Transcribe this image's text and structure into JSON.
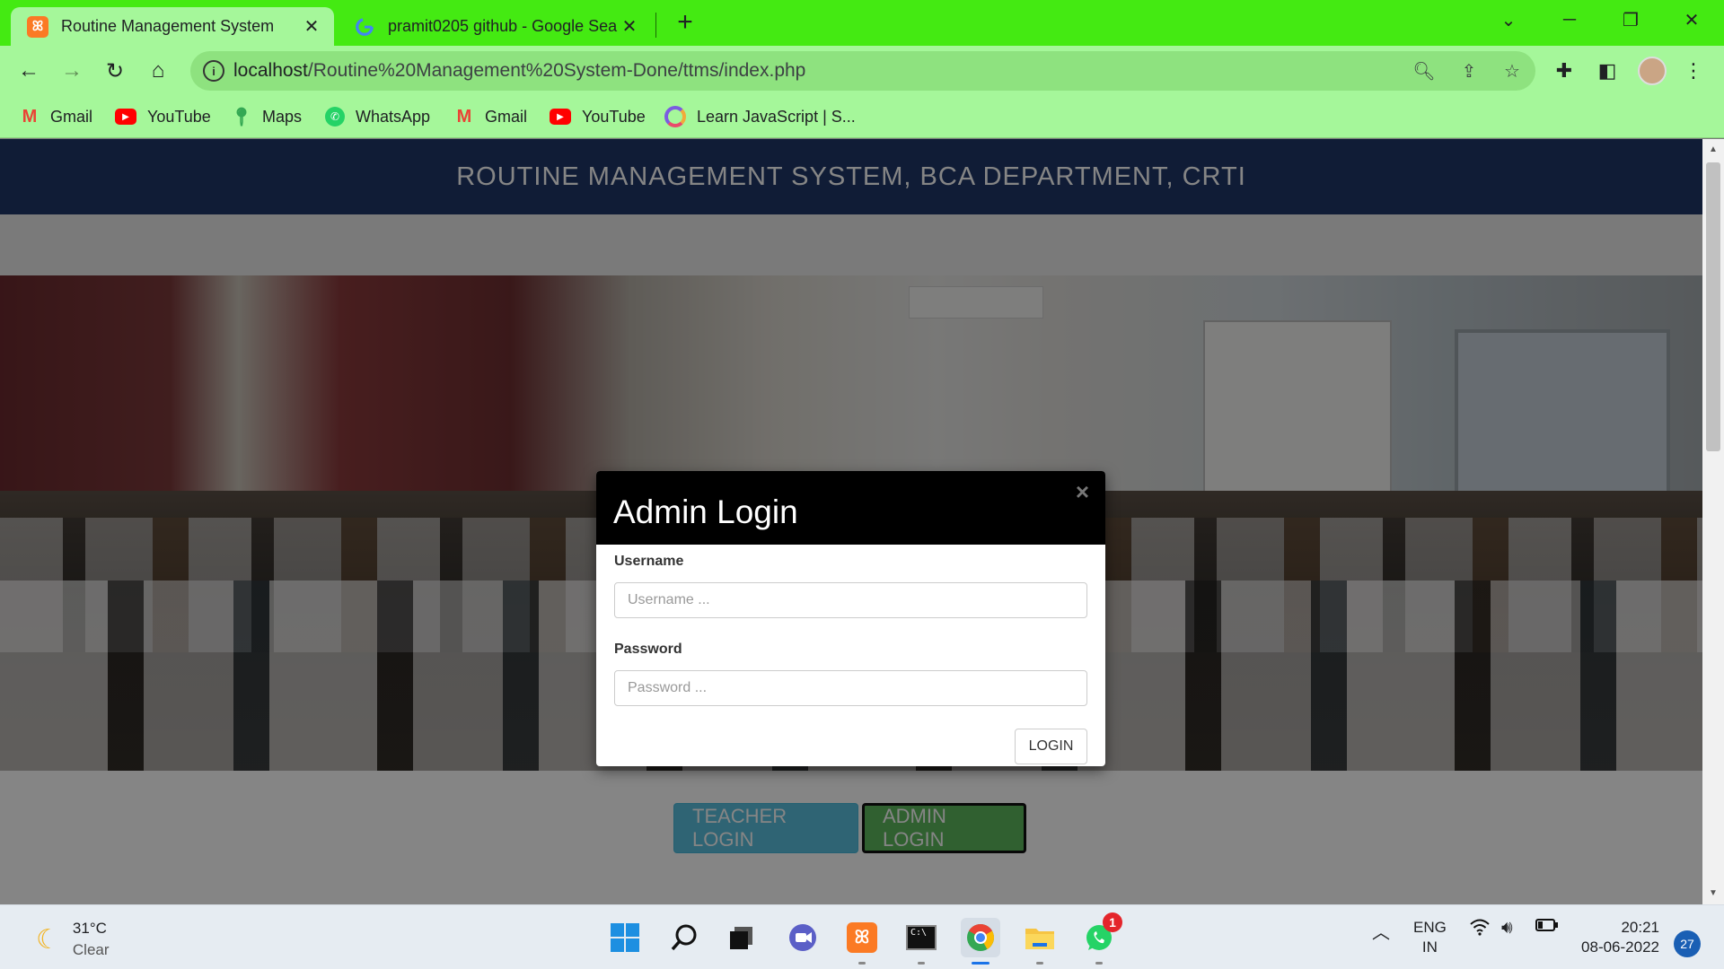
{
  "browser": {
    "tabs": [
      {
        "title": "Routine Management System",
        "icon": "xampp-icon",
        "active": true
      },
      {
        "title": "pramit0205 github - Google Sear",
        "icon": "google-icon",
        "active": false
      }
    ],
    "new_tab_symbol": "+",
    "address": {
      "host": "localhost",
      "path": "/Routine%20Management%20System-Done/ttms/index.php"
    },
    "bookmarks": [
      {
        "label": "Gmail",
        "icon": "gmail-icon"
      },
      {
        "label": "YouTube",
        "icon": "youtube-icon"
      },
      {
        "label": "Maps",
        "icon": "maps-icon"
      },
      {
        "label": "WhatsApp",
        "icon": "whatsapp-icon"
      },
      {
        "label": "Gmail",
        "icon": "gmail-icon"
      },
      {
        "label": "YouTube",
        "icon": "youtube-icon"
      },
      {
        "label": "Learn JavaScript | S...",
        "icon": "javascript-course-icon"
      }
    ],
    "theme_color": "#44ea12"
  },
  "page": {
    "header_title": "ROUTINE MANAGEMENT SYSTEM, BCA DEPARTMENT, CRTI",
    "header_color": "#1f3769",
    "carousel": {
      "slides": 4,
      "active_index": 1
    },
    "buttons": {
      "teacher_login": "TEACHER LOGIN",
      "admin_login": "ADMIN LOGIN"
    }
  },
  "modal": {
    "title": "Admin Login",
    "close_symbol": "×",
    "username_label": "Username",
    "username_placeholder": "Username ...",
    "password_label": "Password",
    "password_placeholder": "Password ...",
    "submit_label": "LOGIN"
  },
  "taskbar": {
    "weather": {
      "temp": "31°C",
      "condition": "Clear"
    },
    "apps": [
      "windows-start-icon",
      "search-icon",
      "task-view-icon",
      "teams-chat-icon",
      "xampp-icon",
      "terminal-icon",
      "chrome-icon",
      "file-explorer-icon",
      "whatsapp-icon"
    ],
    "whatsapp_badge": "1",
    "language": {
      "line1": "ENG",
      "line2": "IN"
    },
    "clock": {
      "time": "20:21",
      "date": "08-06-2022"
    },
    "notifications": "27"
  }
}
